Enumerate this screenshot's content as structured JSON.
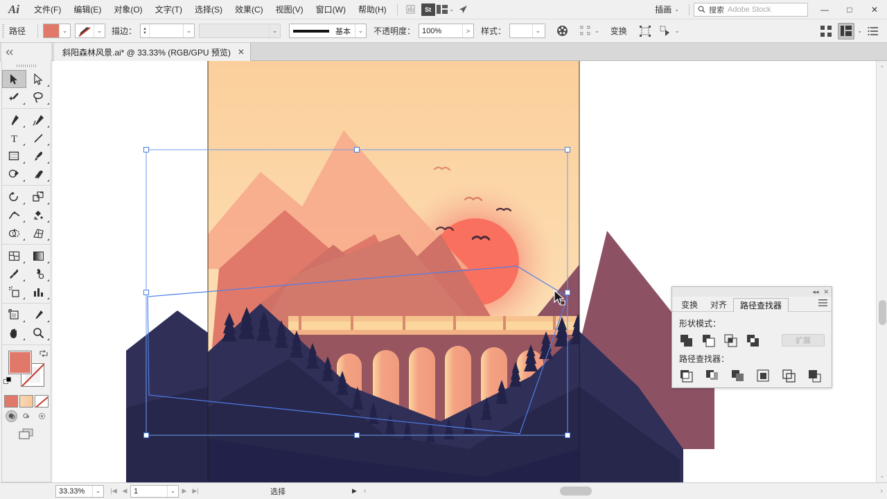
{
  "app": {
    "logo": "Ai"
  },
  "menubar": {
    "items": [
      {
        "label": "文件(F)",
        "name": "menu-file"
      },
      {
        "label": "编辑(E)",
        "name": "menu-edit"
      },
      {
        "label": "对象(O)",
        "name": "menu-object"
      },
      {
        "label": "文字(T)",
        "name": "menu-type"
      },
      {
        "label": "选择(S)",
        "name": "menu-select"
      },
      {
        "label": "效果(C)",
        "name": "menu-effect"
      },
      {
        "label": "视图(V)",
        "name": "menu-view"
      },
      {
        "label": "窗口(W)",
        "name": "menu-window"
      },
      {
        "label": "帮助(H)",
        "name": "menu-help"
      }
    ],
    "bridge_icon": "bridge-icon",
    "stock_icon": "St",
    "arrange_icon": "arrange-documents-icon",
    "sync_icon": "sync-icon",
    "workspace": "插画",
    "search_label": "搜索",
    "search_placeholder": "Adobe Stock",
    "window_minimize": "—",
    "window_maximize": "□",
    "window_close": "✕"
  },
  "controlbar": {
    "object_label": "路径",
    "fill_color": "#e0796a",
    "stroke_label": "描边：",
    "stroke_weight": "",
    "stroke_profile": "",
    "stroke_style_label": "基本",
    "opacity_label": "不透明度：",
    "opacity_value": "100%",
    "style_label": "样式：",
    "recolor_icon": "recolor-artwork-icon",
    "align_icon": "align-icon",
    "transform_label": "变换",
    "isolate_icon": "isolate-selected-icon",
    "select_similar_icon": "select-similar-icon",
    "distribute_icon": "distribute-icon",
    "arrange_layout_icon": "arrange-layout-icon",
    "document_setup_icon": "document-menu-icon"
  },
  "tabbar": {
    "collapse_icon": "collapse-panel-icon",
    "document_title": "斜阳森林风景.ai* @ 33.33% (RGB/GPU 预览)",
    "close_icon": "✕"
  },
  "toolbar": {
    "tools": [
      {
        "name": "selection-tool",
        "glyph": "selection",
        "selected": true
      },
      {
        "name": "direct-selection-tool",
        "glyph": "direct-selection",
        "selected": false
      },
      {
        "name": "magic-wand-tool",
        "glyph": "magic-wand",
        "selected": false
      },
      {
        "name": "lasso-tool",
        "glyph": "lasso",
        "selected": false
      },
      {
        "name": "pen-tool",
        "glyph": "pen",
        "selected": false
      },
      {
        "name": "curvature-tool",
        "glyph": "curvature",
        "selected": false
      },
      {
        "name": "type-tool",
        "glyph": "type",
        "selected": false
      },
      {
        "name": "line-segment-tool",
        "glyph": "line",
        "selected": false
      },
      {
        "name": "rectangle-tool",
        "glyph": "rectangle",
        "selected": false
      },
      {
        "name": "paintbrush-tool",
        "glyph": "paintbrush",
        "selected": false
      },
      {
        "name": "shaper-tool",
        "glyph": "shaper",
        "selected": false
      },
      {
        "name": "eraser-tool",
        "glyph": "eraser",
        "selected": false
      },
      {
        "name": "rotate-tool",
        "glyph": "rotate",
        "selected": false
      },
      {
        "name": "scale-tool",
        "glyph": "scale",
        "selected": false
      },
      {
        "name": "width-tool",
        "glyph": "width",
        "selected": false
      },
      {
        "name": "free-transform-tool",
        "glyph": "free-transform",
        "selected": false
      },
      {
        "name": "shape-builder-tool",
        "glyph": "shape-builder",
        "selected": false
      },
      {
        "name": "perspective-grid-tool",
        "glyph": "perspective-grid",
        "selected": false
      },
      {
        "name": "mesh-tool",
        "glyph": "mesh",
        "selected": false
      },
      {
        "name": "gradient-tool",
        "glyph": "gradient",
        "selected": false
      },
      {
        "name": "eyedropper-tool",
        "glyph": "eyedropper",
        "selected": false
      },
      {
        "name": "blend-tool",
        "glyph": "blend",
        "selected": false
      },
      {
        "name": "symbol-sprayer-tool",
        "glyph": "symbol-sprayer",
        "selected": false
      },
      {
        "name": "column-graph-tool",
        "glyph": "column-graph",
        "selected": false
      },
      {
        "name": "artboard-tool",
        "glyph": "artboard",
        "selected": false
      },
      {
        "name": "slice-tool",
        "glyph": "slice",
        "selected": false
      },
      {
        "name": "hand-tool",
        "glyph": "hand",
        "selected": false
      },
      {
        "name": "zoom-tool",
        "glyph": "zoom",
        "selected": false
      }
    ],
    "fill_color": "#e0796a",
    "stroke_color": "#ffffff",
    "mode_color": "#e0796a",
    "mode_gradient": "#f7cda2",
    "draw_modes": [
      "draw-normal",
      "draw-behind",
      "draw-inside"
    ],
    "screen_mode_icon": "screen-mode-icon"
  },
  "statusbar": {
    "zoom_value": "33.33%",
    "page_value": "1",
    "status_text": "选择",
    "first_icon": "|◀",
    "prev_icon": "◀",
    "next_icon": "▶",
    "last_icon": "▶|"
  },
  "pathfinder_panel": {
    "collapse_icon": "collapse-icon",
    "close_icon": "✕",
    "tabs": [
      {
        "label": "变换",
        "name": "tab-transform",
        "active": false
      },
      {
        "label": "对齐",
        "name": "tab-align",
        "active": false
      },
      {
        "label": "路径查找器",
        "name": "tab-pathfinder",
        "active": true
      }
    ],
    "menu_icon": "panel-menu-icon",
    "shape_modes_label": "形状模式：",
    "shape_mode_buttons": [
      "unite",
      "minus-front",
      "intersect",
      "exclude"
    ],
    "expand_label": "扩展",
    "pathfinders_label": "路径查找器：",
    "pathfinder_buttons": [
      "divide",
      "trim",
      "merge",
      "crop",
      "outline",
      "minus-back"
    ]
  },
  "artwork": {
    "title": "斜阳森林风景",
    "sky_top": "#fbd4a3",
    "sky_bottom": "#fce4c0",
    "sun_core": "#f9705f",
    "sun_halo": "#f79d84",
    "mountain_back": "#f19b7e",
    "mountain_mid": "#e0796a",
    "mountain_front": "#cc7268",
    "mountain_right": "#8c5263",
    "viaduct_arch": "#f2a182",
    "viaduct_light": "#fbd79e",
    "forest_dark": "#2a2a52",
    "forest_darker": "#232347",
    "bird_color": "#3a2230",
    "selection_color": "#4a7fe0"
  }
}
